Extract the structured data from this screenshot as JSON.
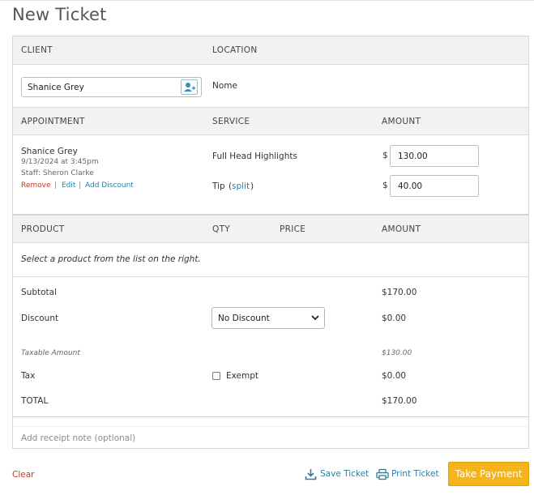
{
  "page_title": "New Ticket",
  "client_section": {
    "client_header": "CLIENT",
    "location_header": "LOCATION",
    "client_value": "Shanice Grey",
    "location_value": "Nome"
  },
  "appointment_section": {
    "appointment_header": "APPOINTMENT",
    "service_header": "SERVICE",
    "amount_header": "AMOUNT",
    "client_name": "Shanice Grey",
    "datetime": "9/13/2024 at 3:45pm",
    "staff": "Staff: Sheron Clarke",
    "remove_label": "Remove",
    "edit_label": "Edit",
    "add_discount_label": "Add Discount",
    "separator": "|",
    "service_name": "Full Head Highlights",
    "currency_symbol": "$",
    "service_amount": "130.00",
    "tip_label": "Tip",
    "split_label": "split",
    "tip_amount": "40.00"
  },
  "product_section": {
    "product_header": "PRODUCT",
    "qty_header": "QTY",
    "price_header": "PRICE",
    "amount_header": "AMOUNT",
    "empty_message": "Select a product from the list on the right."
  },
  "totals": {
    "subtotal_label": "Subtotal",
    "subtotal_value": "$170.00",
    "discount_label": "Discount",
    "discount_selected": "No Discount",
    "discount_value": "$0.00",
    "taxable_label": "Taxable Amount",
    "taxable_value": "$130.00",
    "tax_label": "Tax",
    "exempt_label": "Exempt",
    "tax_value": "$0.00",
    "total_label": "TOTAL",
    "total_value": "$170.00"
  },
  "receipt_note_placeholder": "Add receipt note (optional)",
  "footer": {
    "clear_label": "Clear",
    "save_label": "Save Ticket",
    "print_label": "Print Ticket",
    "pay_label": "Take Payment"
  },
  "colors": {
    "accent_link": "#2a7fa8",
    "danger": "#c0392b",
    "primary_button": "#f4b41a"
  }
}
